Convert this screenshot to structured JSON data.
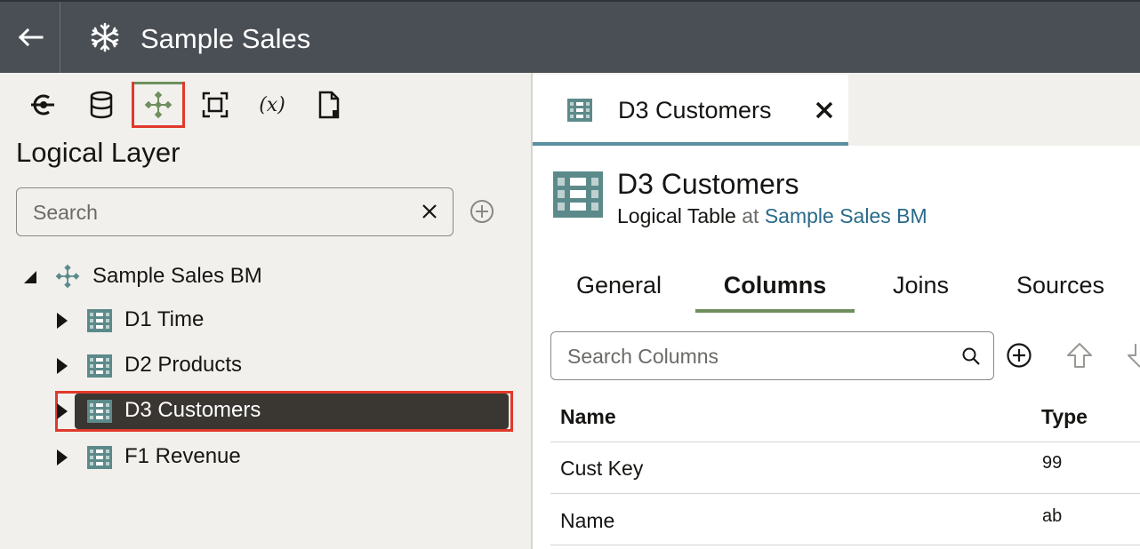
{
  "header": {
    "back_icon": "arrow-left-icon",
    "app_icon": "snowflake-icon",
    "title": "Sample Sales"
  },
  "toolbar": {
    "tools": [
      {
        "icon": "connection-icon",
        "active": false
      },
      {
        "icon": "database-icon",
        "active": false
      },
      {
        "icon": "logical-model-icon",
        "active": true
      },
      {
        "icon": "presentation-frame-icon",
        "active": false
      },
      {
        "icon": "variable-icon",
        "label": "(x)",
        "active": false
      },
      {
        "icon": "document-icon",
        "active": false
      }
    ]
  },
  "left_panel": {
    "title": "Logical Layer",
    "search": {
      "placeholder": "Search",
      "value": ""
    },
    "tree": {
      "root": {
        "label": "Sample Sales BM",
        "expanded": true,
        "icon": "logical-model-icon"
      },
      "children": [
        {
          "label": "D1 Time",
          "icon": "table-icon",
          "selected": false
        },
        {
          "label": "D2 Products",
          "icon": "table-icon",
          "selected": false
        },
        {
          "label": "D3 Customers",
          "icon": "table-icon",
          "selected": true
        },
        {
          "label": "F1 Revenue",
          "icon": "table-icon",
          "selected": false
        }
      ]
    }
  },
  "editor": {
    "open_tab": {
      "label": "D3 Customers",
      "icon": "table-icon",
      "close_icon": "close-icon"
    },
    "entity": {
      "name": "D3 Customers",
      "type": "Logical Table",
      "at": "at",
      "parent": "Sample Sales BM"
    },
    "tabs": [
      {
        "label": "General",
        "active": false
      },
      {
        "label": "Columns",
        "active": true
      },
      {
        "label": "Joins",
        "active": false
      },
      {
        "label": "Sources",
        "active": false
      }
    ],
    "columns_search": {
      "placeholder": "Search Columns",
      "value": ""
    },
    "columns_table": {
      "headers": [
        "Name",
        "Type"
      ],
      "rows": [
        {
          "name": "Cust Key",
          "type": "99"
        },
        {
          "name": "Name",
          "type": "ab"
        }
      ]
    }
  },
  "colors": {
    "header_bg": "#4a4f55",
    "panel_bg": "#f1f0ed",
    "accent_green": "#6f8f5c",
    "highlight_red": "#e0392b",
    "tab_underline": "#5b8fa0",
    "link": "#2a6a8a",
    "selected_row_bg": "#3a3632",
    "table_icon": "#5c8a8a"
  }
}
